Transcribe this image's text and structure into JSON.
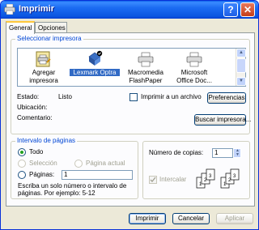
{
  "window": {
    "title": "Imprimir",
    "help_glyph": "?",
    "close_glyph": "✕"
  },
  "tabs": [
    {
      "label": "General"
    },
    {
      "label": "Opciones"
    }
  ],
  "printer_group": {
    "label": "Seleccionar impresora",
    "printers": [
      {
        "label_line1": "Agregar",
        "label_line2": "impresora",
        "icon": "add-printer-icon"
      },
      {
        "label_line1": "Lexmark Optra",
        "label_line2": "",
        "icon": "printer-icon",
        "selected": true
      },
      {
        "label_line1": "Macromedia",
        "label_line2": "FlashPaper",
        "icon": "printer-icon"
      },
      {
        "label_line1": "Microsoft",
        "label_line2": "Office Doc...",
        "icon": "printer-icon"
      }
    ],
    "status_label": "Estado:",
    "status_value": "Listo",
    "location_label": "Ubicación:",
    "location_value": "",
    "comment_label": "Comentario:",
    "comment_value": "",
    "print_to_file_label": "Imprimir a un archivo",
    "preferences_button": "Preferencias",
    "find_printer_button": "Buscar impresora..."
  },
  "range_group": {
    "label": "Intervalo de páginas",
    "all_label": "Todo",
    "selection_label": "Selección",
    "current_page_label": "Página actual",
    "pages_label": "Páginas:",
    "pages_value": "1",
    "hint_line1": "Escriba un solo número o intervalo de",
    "hint_line2": "páginas. Por ejemplo: 5-12"
  },
  "copies": {
    "label": "Número de copias:",
    "value": "1",
    "collate_label": "Intercalar"
  },
  "footer": {
    "print_button": "Imprimir",
    "cancel_button": "Cancelar",
    "apply_button": "Aplicar"
  }
}
